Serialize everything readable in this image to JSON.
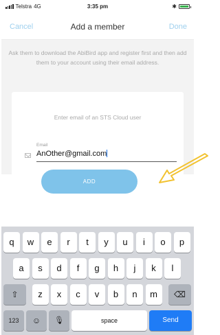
{
  "status_bar": {
    "carrier": "Telstra",
    "network": "4G",
    "time": "3:35 pm"
  },
  "nav": {
    "cancel_label": "Cancel",
    "title": "Add a member",
    "done_label": "Done"
  },
  "instructions": "Ask them to download the AbiBird app and register first and then add them to your account using their email address.",
  "card": {
    "prompt": "Enter email of an STS Cloud user",
    "email_label": "Email",
    "email_value": "AnOther@gmail.com"
  },
  "add_button_label": "ADD",
  "keyboard": {
    "row1": [
      "q",
      "w",
      "e",
      "r",
      "t",
      "y",
      "u",
      "i",
      "o",
      "p"
    ],
    "row2": [
      "a",
      "s",
      "d",
      "f",
      "g",
      "h",
      "j",
      "k",
      "l"
    ],
    "row3": [
      "z",
      "x",
      "c",
      "v",
      "b",
      "n",
      "m"
    ],
    "numbers_label": "123",
    "space_label": "space",
    "send_label": "Send"
  },
  "colors": {
    "accent": "#7fc3ea",
    "send": "#1f7cf6",
    "arrow": "#f2c230"
  }
}
